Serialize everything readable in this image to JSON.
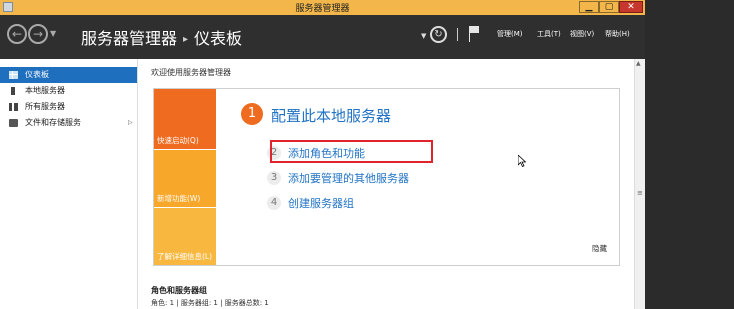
{
  "window": {
    "title": "服务器管理器",
    "minimize_label": "▁",
    "maximize_label": "▢",
    "close_label": "✕"
  },
  "header": {
    "breadcrumb_root": "服务器管理器",
    "breadcrumb_sep": "▸",
    "breadcrumb_current": "仪表板",
    "menus": [
      "管理(M)",
      "工具(T)",
      "视图(V)",
      "帮助(H)"
    ]
  },
  "sidebar": {
    "items": [
      {
        "label": "仪表板",
        "icon": "dashboard-grid-icon",
        "active": true
      },
      {
        "label": "本地服务器",
        "icon": "server-icon"
      },
      {
        "label": "所有服务器",
        "icon": "servers-icon"
      },
      {
        "label": "文件和存储服务",
        "icon": "folder-icon",
        "expand": "▷"
      }
    ]
  },
  "main": {
    "welcome": "欢迎使用服务器管理器",
    "tiles": {
      "quick": "快速启动(Q)",
      "new": "新增功能(W)",
      "learn": "了解详细信息(L)"
    },
    "step1": {
      "num": "1",
      "label": "配置此本地服务器"
    },
    "steps": [
      {
        "num": "2",
        "label": "添加角色和功能"
      },
      {
        "num": "3",
        "label": "添加要管理的其他服务器"
      },
      {
        "num": "4",
        "label": "创建服务器组"
      }
    ],
    "hide": "隐藏",
    "roles_title": "角色和服务器组",
    "roles_sub": "角色: 1 | 服务器组: 1 | 服务器总数: 1"
  },
  "colors": {
    "accent": "#1f6fbf",
    "orange": "#ee6b1f",
    "link": "#2273c4",
    "highlight": "#e0242b"
  }
}
